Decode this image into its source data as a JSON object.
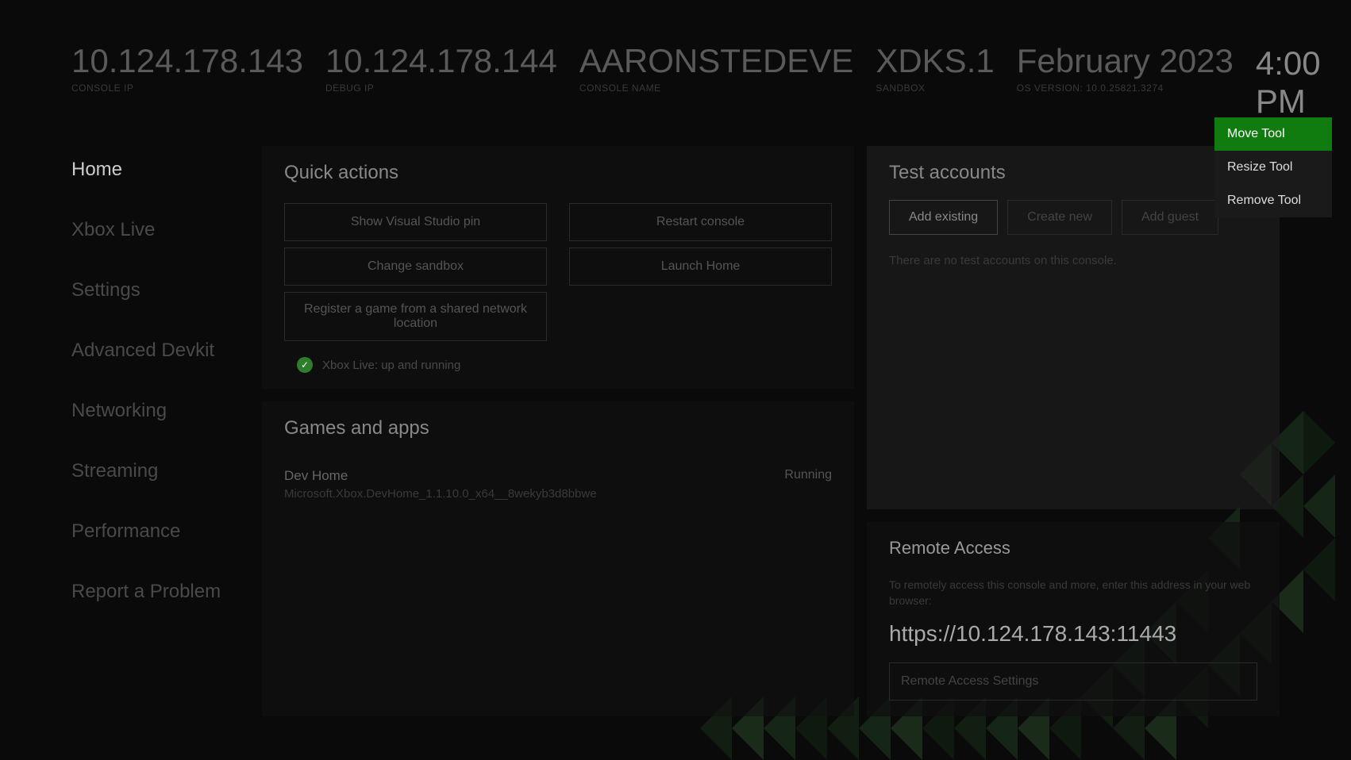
{
  "header": {
    "console_ip": {
      "value": "10.124.178.143",
      "label": "CONSOLE IP"
    },
    "debug_ip": {
      "value": "10.124.178.144",
      "label": "DEBUG IP"
    },
    "console_name": {
      "value": "AARONSTEDEVE",
      "label": "CONSOLE NAME"
    },
    "sandbox": {
      "value": "XDKS.1",
      "label": "SANDBOX"
    },
    "os_version": {
      "value": "February 2023",
      "label": "OS VERSION: 10.0.25821.3274"
    },
    "time": "4:00 PM"
  },
  "sidebar": {
    "items": [
      {
        "label": "Home",
        "active": true
      },
      {
        "label": "Xbox Live"
      },
      {
        "label": "Settings"
      },
      {
        "label": "Advanced Devkit"
      },
      {
        "label": "Networking"
      },
      {
        "label": "Streaming"
      },
      {
        "label": "Performance"
      },
      {
        "label": "Report a Problem"
      }
    ]
  },
  "quick_actions": {
    "title": "Quick actions",
    "buttons": {
      "show_vs_pin": "Show Visual Studio pin",
      "restart_console": "Restart console",
      "change_sandbox": "Change sandbox",
      "launch_home": "Launch Home",
      "register_game": "Register a game from a shared network location"
    },
    "status_text": "Xbox Live: up and running"
  },
  "games_apps": {
    "title": "Games and apps",
    "items": [
      {
        "name": "Dev Home",
        "id": "Microsoft.Xbox.DevHome_1.1.10.0_x64__8wekyb3d8bbwe",
        "status": "Running"
      }
    ]
  },
  "test_accounts": {
    "title": "Test accounts",
    "add_existing": "Add existing",
    "create_new": "Create new",
    "add_guest": "Add guest",
    "empty": "There are no test accounts on this console."
  },
  "remote_access": {
    "title": "Remote Access",
    "desc": "To remotely access this console and more, enter this address in your web browser:",
    "url": "https://10.124.178.143:11443",
    "settings_btn": "Remote Access Settings"
  },
  "context_menu": {
    "move": "Move Tool",
    "resize": "Resize Tool",
    "remove": "Remove Tool"
  }
}
